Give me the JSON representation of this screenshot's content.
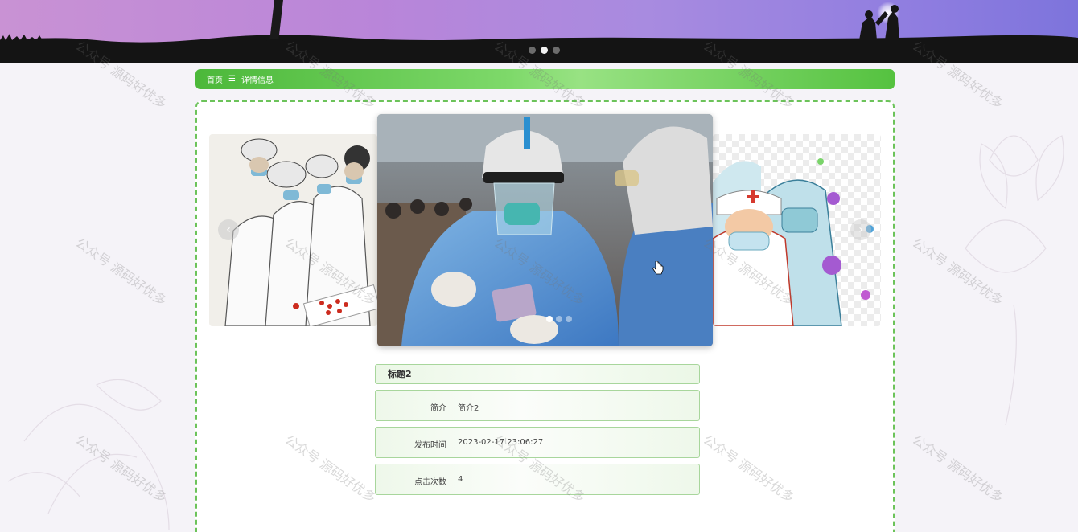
{
  "breadcrumb": {
    "home": "首页",
    "separator": "☰",
    "current": "详情信息"
  },
  "banner": {
    "slides": 3,
    "active_slide": 2
  },
  "carousel": {
    "slides": 3,
    "active_slide": 1,
    "prev_icon": "chevron-left-icon",
    "next_icon": "chevron-right-icon"
  },
  "detail": {
    "title": "标题2",
    "rows": [
      {
        "label": "简介",
        "value": "简介2"
      },
      {
        "label": "发布时间",
        "value": "2023-02-17 23:06:27"
      },
      {
        "label": "点击次数",
        "value": "4"
      }
    ]
  },
  "watermark": "公众号 源码好优多",
  "colors": {
    "accent_green": "#5cc247",
    "panel_border": "#6cc35a",
    "row_border": "#a8d69c"
  }
}
